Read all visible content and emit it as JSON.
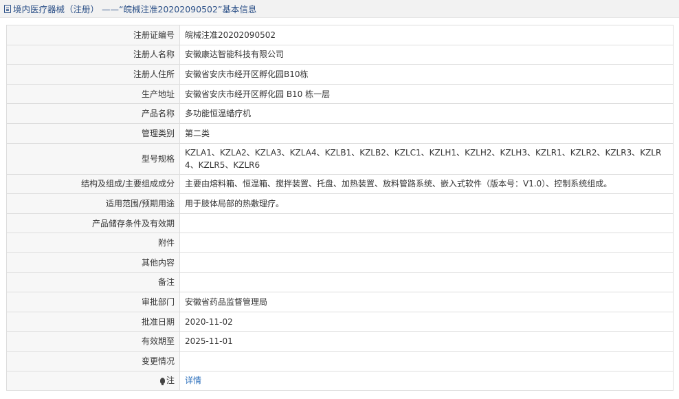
{
  "header": {
    "title": "境内医疗器械（注册） ——“皖械注准20202090502”基本信息"
  },
  "rows": [
    {
      "label": "注册证编号",
      "value": "皖械注准20202090502"
    },
    {
      "label": "注册人名称",
      "value": "安徽康达智能科技有限公司"
    },
    {
      "label": "注册人住所",
      "value": "安徽省安庆市经开区孵化园B10栋"
    },
    {
      "label": "生产地址",
      "value": "安徽省安庆市经开区孵化园 B10 栋一层"
    },
    {
      "label": "产品名称",
      "value": "多功能恒温蜡疗机"
    },
    {
      "label": "管理类别",
      "value": "第二类"
    },
    {
      "label": "型号规格",
      "value": "KZLA1、KZLA2、KZLA3、KZLA4、KZLB1、KZLB2、KZLC1、KZLH1、KZLH2、KZLH3、KZLR1、KZLR2、KZLR3、KZLR4、KZLR5、KZLR6"
    },
    {
      "label": "结构及组成/主要组成成分",
      "value": "主要由熔料箱、恒温箱、搅拌装置、托盘、加热装置、放料管路系统、嵌入式软件（版本号：V1.0）、控制系统组成。"
    },
    {
      "label": "适用范围/预期用途",
      "value": "用于肢体局部的热敷理疗。"
    },
    {
      "label": "产品储存条件及有效期",
      "value": ""
    },
    {
      "label": "附件",
      "value": ""
    },
    {
      "label": "其他内容",
      "value": ""
    },
    {
      "label": "备注",
      "value": ""
    },
    {
      "label": "审批部门",
      "value": "安徽省药品监督管理局"
    },
    {
      "label": "批准日期",
      "value": "2020-11-02"
    },
    {
      "label": "有效期至",
      "value": "2025-11-01"
    },
    {
      "label": "变更情况",
      "value": ""
    }
  ],
  "note_row": {
    "label": "注",
    "icon": "bulb-icon",
    "link": "详情"
  }
}
